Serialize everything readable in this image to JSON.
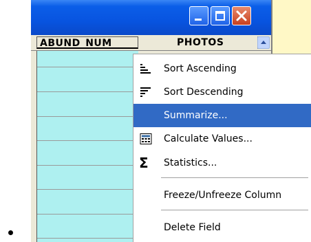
{
  "table": {
    "columns": [
      "ABUND_NUM",
      "PHOTOS"
    ]
  },
  "context_menu": {
    "items": [
      {
        "label": "Sort Ascending",
        "icon": "sort-ascending-icon"
      },
      {
        "label": "Sort Descending",
        "icon": "sort-descending-icon"
      },
      {
        "label": "Summarize...",
        "icon": "",
        "selected": true
      },
      {
        "label": "Calculate Values...",
        "icon": "calculator-icon"
      },
      {
        "label": "Statistics...",
        "icon": "sigma-icon",
        "glyph": "Σ"
      },
      {
        "label": "Freeze/Unfreeze Column",
        "icon": ""
      },
      {
        "label": "Delete Field",
        "icon": ""
      }
    ]
  },
  "colors": {
    "titlebar": "#0854e0",
    "grid_cell": "#aef0f0",
    "menu_highlight": "#316ac5",
    "right_panel": "#fff8c6"
  }
}
